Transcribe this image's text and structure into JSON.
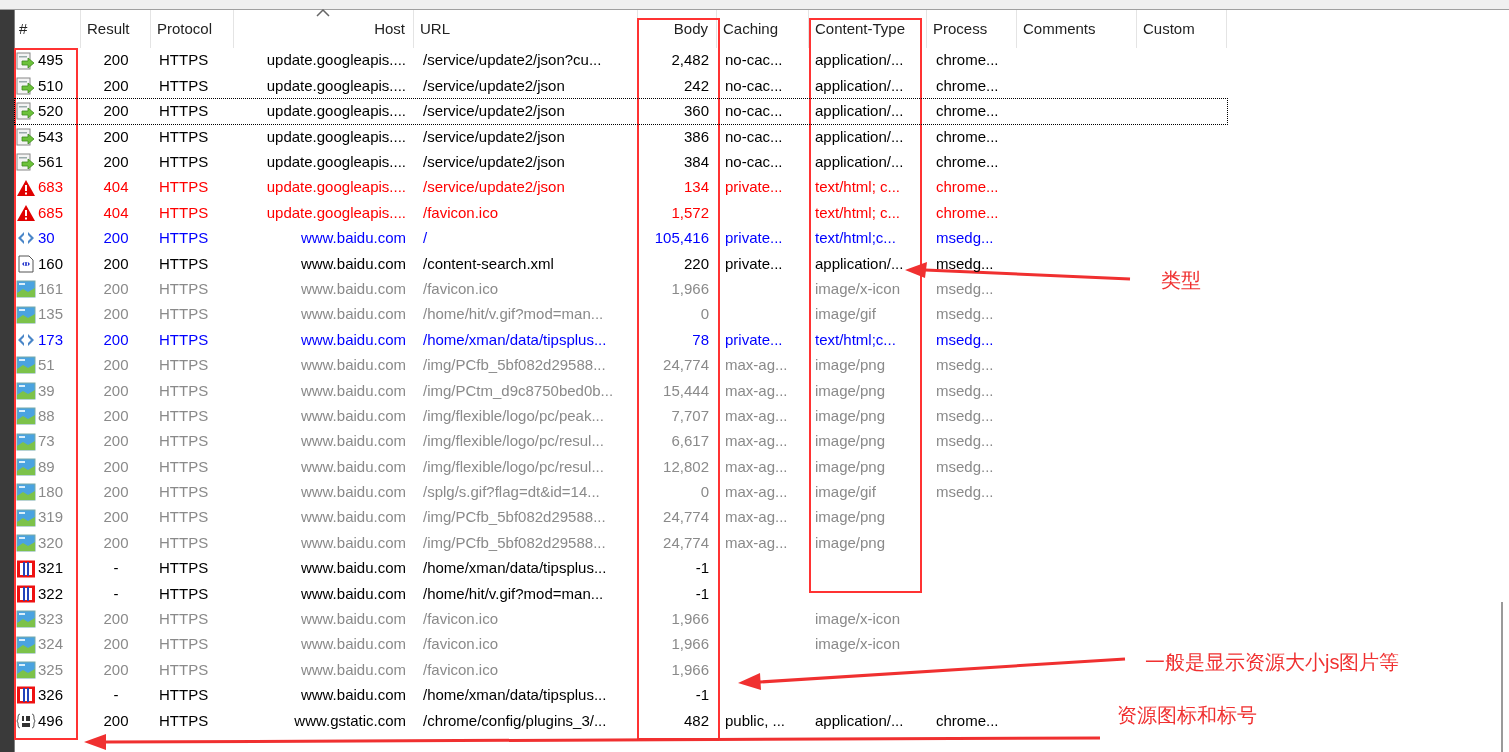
{
  "columns": [
    {
      "label": "#",
      "sorted": false
    },
    {
      "label": "Result",
      "sorted": false
    },
    {
      "label": "Protocol",
      "sorted": false
    },
    {
      "label": "Host",
      "sorted": true
    },
    {
      "label": "URL",
      "sorted": false
    },
    {
      "label": "Body",
      "sorted": false
    },
    {
      "label": "Caching",
      "sorted": false
    },
    {
      "label": "Content-Type",
      "sorted": false
    },
    {
      "label": "Process",
      "sorted": false
    },
    {
      "label": "Comments",
      "sorted": false
    },
    {
      "label": "Custom",
      "sorted": false
    }
  ],
  "rows": [
    {
      "kind": "json",
      "focused": false,
      "id": "495",
      "result": "200",
      "protocol": "HTTPS",
      "host": "update.googleapis....",
      "url": "/service/update2/json?cu...",
      "body": "2,482",
      "caching": "no-cac...",
      "content_type": "application/...",
      "process": "chrome..."
    },
    {
      "kind": "json",
      "focused": false,
      "id": "510",
      "result": "200",
      "protocol": "HTTPS",
      "host": "update.googleapis....",
      "url": "/service/update2/json",
      "body": "242",
      "caching": "no-cac...",
      "content_type": "application/...",
      "process": "chrome..."
    },
    {
      "kind": "json",
      "focused": true,
      "id": "520",
      "result": "200",
      "protocol": "HTTPS",
      "host": "update.googleapis....",
      "url": "/service/update2/json",
      "body": "360",
      "caching": "no-cac...",
      "content_type": "application/...",
      "process": "chrome..."
    },
    {
      "kind": "json",
      "focused": false,
      "id": "543",
      "result": "200",
      "protocol": "HTTPS",
      "host": "update.googleapis....",
      "url": "/service/update2/json",
      "body": "386",
      "caching": "no-cac...",
      "content_type": "application/...",
      "process": "chrome..."
    },
    {
      "kind": "json",
      "focused": false,
      "id": "561",
      "result": "200",
      "protocol": "HTTPS",
      "host": "update.googleapis....",
      "url": "/service/update2/json",
      "body": "384",
      "caching": "no-cac...",
      "content_type": "application/...",
      "process": "chrome..."
    },
    {
      "kind": "warning",
      "focused": false,
      "id": "683",
      "result": "404",
      "protocol": "HTTPS",
      "host": "update.googleapis....",
      "url": "/service/update2/json",
      "body": "134",
      "caching": "private...",
      "content_type": "text/html; c...",
      "process": "chrome..."
    },
    {
      "kind": "warning",
      "focused": false,
      "id": "685",
      "result": "404",
      "protocol": "HTTPS",
      "host": "update.googleapis....",
      "url": "/favicon.ico",
      "body": "1,572",
      "content_type": "text/html; c...",
      "process": "chrome..."
    },
    {
      "kind": "html",
      "focused": false,
      "id": "30",
      "result": "200",
      "protocol": "HTTPS",
      "host": "www.baidu.com",
      "url": "/",
      "body": "105,416",
      "caching": "private...",
      "content_type": "text/html;c...",
      "process": "msedg..."
    },
    {
      "kind": "xml",
      "focused": false,
      "id": "160",
      "result": "200",
      "protocol": "HTTPS",
      "host": "www.baidu.com",
      "url": "/content-search.xml",
      "body": "220",
      "caching": "private...",
      "content_type": "application/...",
      "process": "msedg..."
    },
    {
      "kind": "image",
      "focused": false,
      "id": "161",
      "result": "200",
      "protocol": "HTTPS",
      "host": "www.baidu.com",
      "url": "/favicon.ico",
      "body": "1,966",
      "content_type": "image/x-icon",
      "process": "msedg..."
    },
    {
      "kind": "image",
      "focused": false,
      "id": "135",
      "result": "200",
      "protocol": "HTTPS",
      "host": "www.baidu.com",
      "url": "/home/hit/v.gif?mod=man...",
      "body": "0",
      "content_type": "image/gif",
      "process": "msedg..."
    },
    {
      "kind": "html",
      "focused": false,
      "id": "173",
      "result": "200",
      "protocol": "HTTPS",
      "host": "www.baidu.com",
      "url": "/home/xman/data/tipsplus...",
      "body": "78",
      "caching": "private...",
      "content_type": "text/html;c...",
      "process": "msedg..."
    },
    {
      "kind": "image",
      "focused": false,
      "id": "51",
      "result": "200",
      "protocol": "HTTPS",
      "host": "www.baidu.com",
      "url": "/img/PCfb_5bf082d29588...",
      "body": "24,774",
      "caching": "max-ag...",
      "content_type": "image/png",
      "process": "msedg..."
    },
    {
      "kind": "image",
      "focused": false,
      "id": "39",
      "result": "200",
      "protocol": "HTTPS",
      "host": "www.baidu.com",
      "url": "/img/PCtm_d9c8750bed0b...",
      "body": "15,444",
      "caching": "max-ag...",
      "content_type": "image/png",
      "process": "msedg..."
    },
    {
      "kind": "image",
      "focused": false,
      "id": "88",
      "result": "200",
      "protocol": "HTTPS",
      "host": "www.baidu.com",
      "url": "/img/flexible/logo/pc/peak...",
      "body": "7,707",
      "caching": "max-ag...",
      "content_type": "image/png",
      "process": "msedg..."
    },
    {
      "kind": "image",
      "focused": false,
      "id": "73",
      "result": "200",
      "protocol": "HTTPS",
      "host": "www.baidu.com",
      "url": "/img/flexible/logo/pc/resul...",
      "body": "6,617",
      "caching": "max-ag...",
      "content_type": "image/png",
      "process": "msedg..."
    },
    {
      "kind": "image",
      "focused": false,
      "id": "89",
      "result": "200",
      "protocol": "HTTPS",
      "host": "www.baidu.com",
      "url": "/img/flexible/logo/pc/resul...",
      "body": "12,802",
      "caching": "max-ag...",
      "content_type": "image/png",
      "process": "msedg..."
    },
    {
      "kind": "image",
      "focused": false,
      "id": "180",
      "result": "200",
      "protocol": "HTTPS",
      "host": "www.baidu.com",
      "url": "/splg/s.gif?flag=dt&id=14...",
      "body": "0",
      "caching": "max-ag...",
      "content_type": "image/gif",
      "process": "msedg..."
    },
    {
      "kind": "image",
      "focused": false,
      "id": "319",
      "result": "200",
      "protocol": "HTTPS",
      "host": "www.baidu.com",
      "url": "/img/PCfb_5bf082d29588...",
      "body": "24,774",
      "caching": "max-ag...",
      "content_type": "image/png"
    },
    {
      "kind": "image",
      "focused": false,
      "id": "320",
      "result": "200",
      "protocol": "HTTPS",
      "host": "www.baidu.com",
      "url": "/img/PCfb_5bf082d29588...",
      "body": "24,774",
      "caching": "max-ag...",
      "content_type": "image/png"
    },
    {
      "kind": "blocked",
      "focused": false,
      "id": "321",
      "result": "-",
      "protocol": "HTTPS",
      "host": "www.baidu.com",
      "url": "/home/xman/data/tipsplus...",
      "body": "-1"
    },
    {
      "kind": "blocked",
      "focused": false,
      "id": "322",
      "result": "-",
      "protocol": "HTTPS",
      "host": "www.baidu.com",
      "url": "/home/hit/v.gif?mod=man...",
      "body": "-1"
    },
    {
      "kind": "image",
      "focused": false,
      "id": "323",
      "result": "200",
      "protocol": "HTTPS",
      "host": "www.baidu.com",
      "url": "/favicon.ico",
      "body": "1,966",
      "content_type": "image/x-icon"
    },
    {
      "kind": "image",
      "focused": false,
      "id": "324",
      "result": "200",
      "protocol": "HTTPS",
      "host": "www.baidu.com",
      "url": "/favicon.ico",
      "body": "1,966",
      "content_type": "image/x-icon"
    },
    {
      "kind": "image",
      "focused": false,
      "id": "325",
      "result": "200",
      "protocol": "HTTPS",
      "host": "www.baidu.com",
      "url": "/favicon.ico",
      "body": "1,966"
    },
    {
      "kind": "blocked",
      "focused": false,
      "id": "326",
      "result": "-",
      "protocol": "HTTPS",
      "host": "www.baidu.com",
      "url": "/home/xman/data/tipsplus...",
      "body": "-1"
    },
    {
      "kind": "js",
      "focused": false,
      "id": "496",
      "result": "200",
      "protocol": "HTTPS",
      "host": "www.gstatic.com",
      "url": "/chrome/config/plugins_3/...",
      "body": "482",
      "caching": "public, ...",
      "content_type": "application/...",
      "process": "chrome..."
    }
  ],
  "annotations": [
    {
      "kind": "type",
      "text": "类型"
    },
    {
      "kind": "size",
      "text": "一般是显示资源大小js图片等"
    },
    {
      "kind": "icon",
      "text": "资源图标和标号"
    }
  ]
}
